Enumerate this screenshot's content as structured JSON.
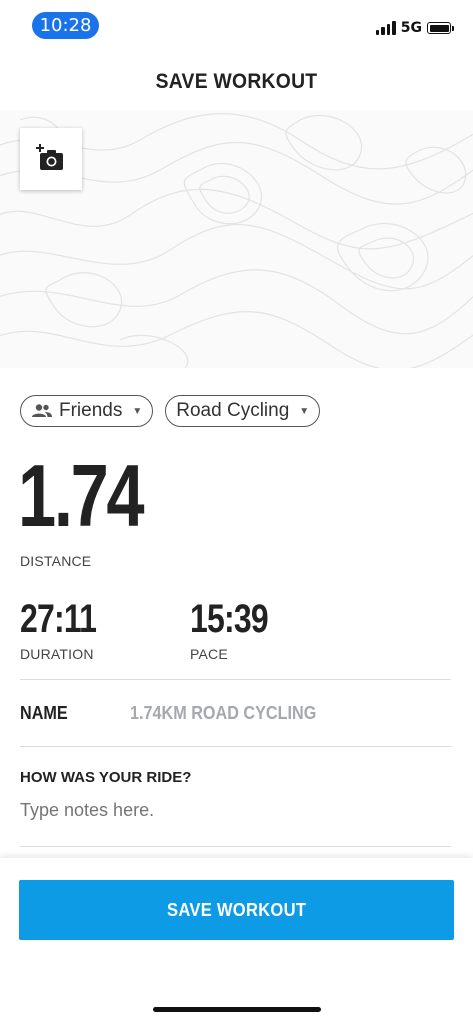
{
  "status_bar": {
    "time": "10:28",
    "network": "5G"
  },
  "header": {
    "title": "SAVE WORKOUT"
  },
  "photo": {
    "icon": "add-photo-camera-icon"
  },
  "chips": {
    "visibility": {
      "label": "Friends",
      "icon": "people-icon"
    },
    "activity": {
      "label": "Road Cycling"
    }
  },
  "stats": {
    "distance": {
      "value": "1.74",
      "label": "DISTANCE"
    },
    "duration": {
      "value": "27:11",
      "label": "DURATION"
    },
    "pace": {
      "value": "15:39",
      "label": "PACE"
    }
  },
  "name": {
    "label": "NAME",
    "value": "1.74KM ROAD CYCLING"
  },
  "notes": {
    "label": "HOW WAS YOUR RIDE?",
    "placeholder": "Type notes here."
  },
  "footer": {
    "save_label": "SAVE WORKOUT"
  },
  "colors": {
    "accent": "#0e9be6",
    "time_pill": "#1a73e8"
  }
}
